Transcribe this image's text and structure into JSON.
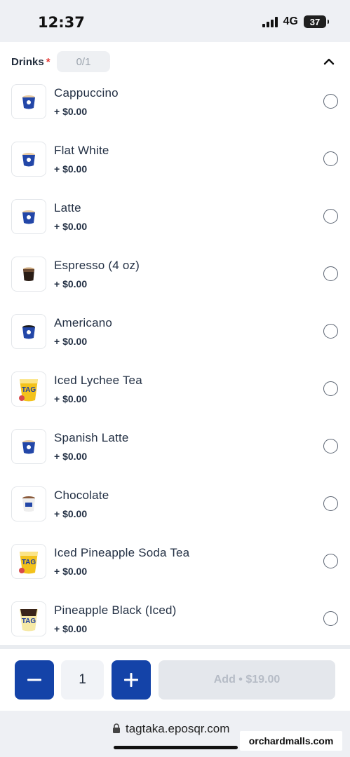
{
  "status_bar": {
    "time": "12:37",
    "network": "4G",
    "battery": "37"
  },
  "section": {
    "title": "Drinks",
    "required_mark": "*",
    "counter": "0/1"
  },
  "items": [
    {
      "name": "Cappuccino",
      "price": "+ $0.00",
      "icon": "cup-icon"
    },
    {
      "name": "Flat White",
      "price": "+ $0.00",
      "icon": "cup-icon"
    },
    {
      "name": "Latte",
      "price": "+ $0.00",
      "icon": "cup-icon"
    },
    {
      "name": "Espresso (4 oz)",
      "price": "+ $0.00",
      "icon": "espresso-icon"
    },
    {
      "name": "Americano",
      "price": "+ $0.00",
      "icon": "dark-cup-icon"
    },
    {
      "name": "Iced Lychee Tea",
      "price": "+ $0.00",
      "icon": "iced-drink-icon"
    },
    {
      "name": "Spanish Latte",
      "price": "+ $0.00",
      "icon": "cup-icon"
    },
    {
      "name": "Chocolate",
      "price": "+ $0.00",
      "icon": "chocolate-cup-icon"
    },
    {
      "name": "Iced Pineapple Soda Tea",
      "price": "+ $0.00",
      "icon": "iced-drink-icon"
    },
    {
      "name": "Pineapple Black (Iced)",
      "price": "+ $0.00",
      "icon": "iced-dark-drink-icon"
    }
  ],
  "footer": {
    "quantity": "1",
    "add_label": "Add • $19.00"
  },
  "browser": {
    "url": "tagtaka.eposqr.com"
  },
  "watermark": "orchardmalls.com",
  "colors": {
    "accent": "#1443a8",
    "required": "#e53935",
    "disabled": "#e4e7ec"
  }
}
